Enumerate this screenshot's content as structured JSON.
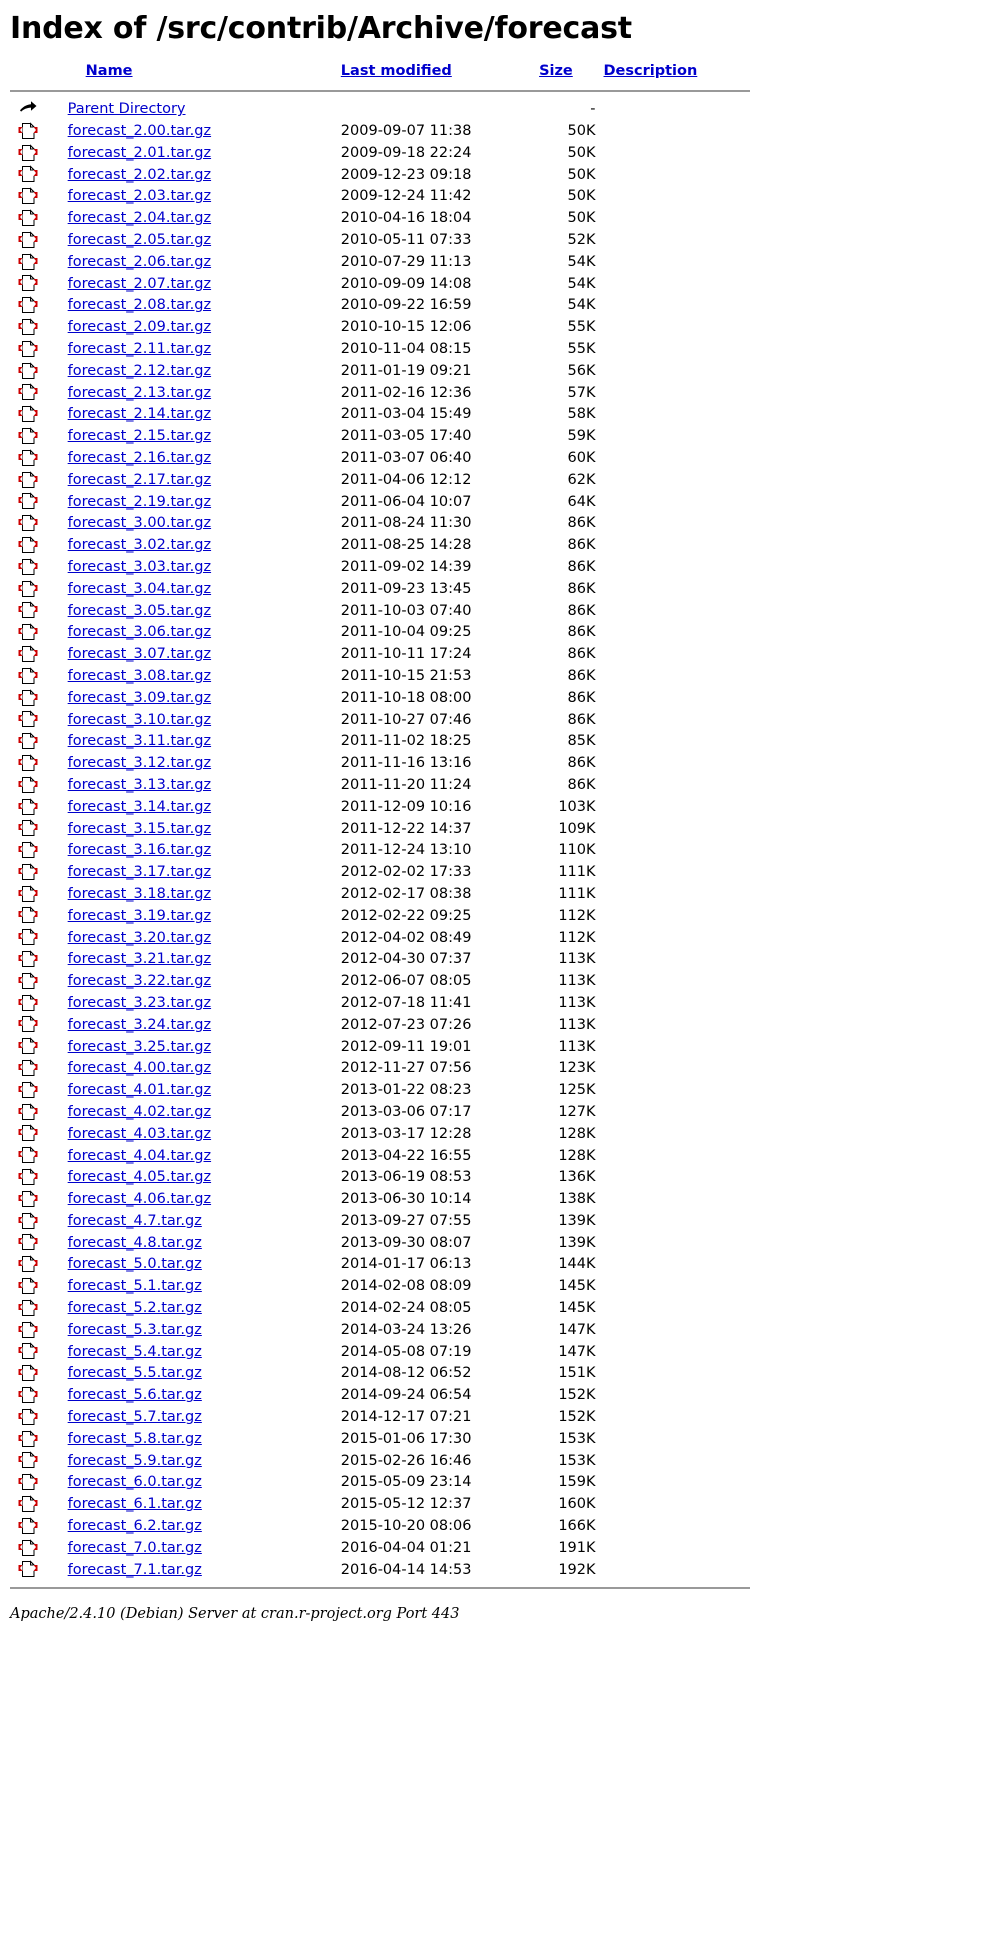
{
  "page": {
    "title": "Index of /src/contrib/Archive/forecast",
    "parent_directory_label": "Parent Directory",
    "parent_directory_size": "-",
    "footer": "Apache/2.4.10 (Debian) Server at cran.r-project.org Port 443"
  },
  "colors": {
    "link": "#0000cc",
    "rule": "#999999",
    "text": "#000000",
    "background": "#ffffff",
    "icon_red": "#cc0000"
  },
  "columns": {
    "icon": "",
    "name": "Name",
    "last_modified": "Last modified",
    "size": "Size",
    "description": "Description"
  },
  "icons": {
    "parent": "back-arrow-icon",
    "file": "compressed-file-icon"
  },
  "rows": [
    {
      "name": "forecast_2.00.tar.gz",
      "modified": "2009-09-07 11:38",
      "size": "50K",
      "description": ""
    },
    {
      "name": "forecast_2.01.tar.gz",
      "modified": "2009-09-18 22:24",
      "size": "50K",
      "description": ""
    },
    {
      "name": "forecast_2.02.tar.gz",
      "modified": "2009-12-23 09:18",
      "size": "50K",
      "description": ""
    },
    {
      "name": "forecast_2.03.tar.gz",
      "modified": "2009-12-24 11:42",
      "size": "50K",
      "description": ""
    },
    {
      "name": "forecast_2.04.tar.gz",
      "modified": "2010-04-16 18:04",
      "size": "50K",
      "description": ""
    },
    {
      "name": "forecast_2.05.tar.gz",
      "modified": "2010-05-11 07:33",
      "size": "52K",
      "description": ""
    },
    {
      "name": "forecast_2.06.tar.gz",
      "modified": "2010-07-29 11:13",
      "size": "54K",
      "description": ""
    },
    {
      "name": "forecast_2.07.tar.gz",
      "modified": "2010-09-09 14:08",
      "size": "54K",
      "description": ""
    },
    {
      "name": "forecast_2.08.tar.gz",
      "modified": "2010-09-22 16:59",
      "size": "54K",
      "description": ""
    },
    {
      "name": "forecast_2.09.tar.gz",
      "modified": "2010-10-15 12:06",
      "size": "55K",
      "description": ""
    },
    {
      "name": "forecast_2.11.tar.gz",
      "modified": "2010-11-04 08:15",
      "size": "55K",
      "description": ""
    },
    {
      "name": "forecast_2.12.tar.gz",
      "modified": "2011-01-19 09:21",
      "size": "56K",
      "description": ""
    },
    {
      "name": "forecast_2.13.tar.gz",
      "modified": "2011-02-16 12:36",
      "size": "57K",
      "description": ""
    },
    {
      "name": "forecast_2.14.tar.gz",
      "modified": "2011-03-04 15:49",
      "size": "58K",
      "description": ""
    },
    {
      "name": "forecast_2.15.tar.gz",
      "modified": "2011-03-05 17:40",
      "size": "59K",
      "description": ""
    },
    {
      "name": "forecast_2.16.tar.gz",
      "modified": "2011-03-07 06:40",
      "size": "60K",
      "description": ""
    },
    {
      "name": "forecast_2.17.tar.gz",
      "modified": "2011-04-06 12:12",
      "size": "62K",
      "description": ""
    },
    {
      "name": "forecast_2.19.tar.gz",
      "modified": "2011-06-04 10:07",
      "size": "64K",
      "description": ""
    },
    {
      "name": "forecast_3.00.tar.gz",
      "modified": "2011-08-24 11:30",
      "size": "86K",
      "description": ""
    },
    {
      "name": "forecast_3.02.tar.gz",
      "modified": "2011-08-25 14:28",
      "size": "86K",
      "description": ""
    },
    {
      "name": "forecast_3.03.tar.gz",
      "modified": "2011-09-02 14:39",
      "size": "86K",
      "description": ""
    },
    {
      "name": "forecast_3.04.tar.gz",
      "modified": "2011-09-23 13:45",
      "size": "86K",
      "description": ""
    },
    {
      "name": "forecast_3.05.tar.gz",
      "modified": "2011-10-03 07:40",
      "size": "86K",
      "description": ""
    },
    {
      "name": "forecast_3.06.tar.gz",
      "modified": "2011-10-04 09:25",
      "size": "86K",
      "description": ""
    },
    {
      "name": "forecast_3.07.tar.gz",
      "modified": "2011-10-11 17:24",
      "size": "86K",
      "description": ""
    },
    {
      "name": "forecast_3.08.tar.gz",
      "modified": "2011-10-15 21:53",
      "size": "86K",
      "description": ""
    },
    {
      "name": "forecast_3.09.tar.gz",
      "modified": "2011-10-18 08:00",
      "size": "86K",
      "description": ""
    },
    {
      "name": "forecast_3.10.tar.gz",
      "modified": "2011-10-27 07:46",
      "size": "86K",
      "description": ""
    },
    {
      "name": "forecast_3.11.tar.gz",
      "modified": "2011-11-02 18:25",
      "size": "85K",
      "description": ""
    },
    {
      "name": "forecast_3.12.tar.gz",
      "modified": "2011-11-16 13:16",
      "size": "86K",
      "description": ""
    },
    {
      "name": "forecast_3.13.tar.gz",
      "modified": "2011-11-20 11:24",
      "size": "86K",
      "description": ""
    },
    {
      "name": "forecast_3.14.tar.gz",
      "modified": "2011-12-09 10:16",
      "size": "103K",
      "description": ""
    },
    {
      "name": "forecast_3.15.tar.gz",
      "modified": "2011-12-22 14:37",
      "size": "109K",
      "description": ""
    },
    {
      "name": "forecast_3.16.tar.gz",
      "modified": "2011-12-24 13:10",
      "size": "110K",
      "description": ""
    },
    {
      "name": "forecast_3.17.tar.gz",
      "modified": "2012-02-02 17:33",
      "size": "111K",
      "description": ""
    },
    {
      "name": "forecast_3.18.tar.gz",
      "modified": "2012-02-17 08:38",
      "size": "111K",
      "description": ""
    },
    {
      "name": "forecast_3.19.tar.gz",
      "modified": "2012-02-22 09:25",
      "size": "112K",
      "description": ""
    },
    {
      "name": "forecast_3.20.tar.gz",
      "modified": "2012-04-02 08:49",
      "size": "112K",
      "description": ""
    },
    {
      "name": "forecast_3.21.tar.gz",
      "modified": "2012-04-30 07:37",
      "size": "113K",
      "description": ""
    },
    {
      "name": "forecast_3.22.tar.gz",
      "modified": "2012-06-07 08:05",
      "size": "113K",
      "description": ""
    },
    {
      "name": "forecast_3.23.tar.gz",
      "modified": "2012-07-18 11:41",
      "size": "113K",
      "description": ""
    },
    {
      "name": "forecast_3.24.tar.gz",
      "modified": "2012-07-23 07:26",
      "size": "113K",
      "description": ""
    },
    {
      "name": "forecast_3.25.tar.gz",
      "modified": "2012-09-11 19:01",
      "size": "113K",
      "description": ""
    },
    {
      "name": "forecast_4.00.tar.gz",
      "modified": "2012-11-27 07:56",
      "size": "123K",
      "description": ""
    },
    {
      "name": "forecast_4.01.tar.gz",
      "modified": "2013-01-22 08:23",
      "size": "125K",
      "description": ""
    },
    {
      "name": "forecast_4.02.tar.gz",
      "modified": "2013-03-06 07:17",
      "size": "127K",
      "description": ""
    },
    {
      "name": "forecast_4.03.tar.gz",
      "modified": "2013-03-17 12:28",
      "size": "128K",
      "description": ""
    },
    {
      "name": "forecast_4.04.tar.gz",
      "modified": "2013-04-22 16:55",
      "size": "128K",
      "description": ""
    },
    {
      "name": "forecast_4.05.tar.gz",
      "modified": "2013-06-19 08:53",
      "size": "136K",
      "description": ""
    },
    {
      "name": "forecast_4.06.tar.gz",
      "modified": "2013-06-30 10:14",
      "size": "138K",
      "description": ""
    },
    {
      "name": "forecast_4.7.tar.gz",
      "modified": "2013-09-27 07:55",
      "size": "139K",
      "description": ""
    },
    {
      "name": "forecast_4.8.tar.gz",
      "modified": "2013-09-30 08:07",
      "size": "139K",
      "description": ""
    },
    {
      "name": "forecast_5.0.tar.gz",
      "modified": "2014-01-17 06:13",
      "size": "144K",
      "description": ""
    },
    {
      "name": "forecast_5.1.tar.gz",
      "modified": "2014-02-08 08:09",
      "size": "145K",
      "description": ""
    },
    {
      "name": "forecast_5.2.tar.gz",
      "modified": "2014-02-24 08:05",
      "size": "145K",
      "description": ""
    },
    {
      "name": "forecast_5.3.tar.gz",
      "modified": "2014-03-24 13:26",
      "size": "147K",
      "description": ""
    },
    {
      "name": "forecast_5.4.tar.gz",
      "modified": "2014-05-08 07:19",
      "size": "147K",
      "description": ""
    },
    {
      "name": "forecast_5.5.tar.gz",
      "modified": "2014-08-12 06:52",
      "size": "151K",
      "description": ""
    },
    {
      "name": "forecast_5.6.tar.gz",
      "modified": "2014-09-24 06:54",
      "size": "152K",
      "description": ""
    },
    {
      "name": "forecast_5.7.tar.gz",
      "modified": "2014-12-17 07:21",
      "size": "152K",
      "description": ""
    },
    {
      "name": "forecast_5.8.tar.gz",
      "modified": "2015-01-06 17:30",
      "size": "153K",
      "description": ""
    },
    {
      "name": "forecast_5.9.tar.gz",
      "modified": "2015-02-26 16:46",
      "size": "153K",
      "description": ""
    },
    {
      "name": "forecast_6.0.tar.gz",
      "modified": "2015-05-09 23:14",
      "size": "159K",
      "description": ""
    },
    {
      "name": "forecast_6.1.tar.gz",
      "modified": "2015-05-12 12:37",
      "size": "160K",
      "description": ""
    },
    {
      "name": "forecast_6.2.tar.gz",
      "modified": "2015-10-20 08:06",
      "size": "166K",
      "description": ""
    },
    {
      "name": "forecast_7.0.tar.gz",
      "modified": "2016-04-04 01:21",
      "size": "191K",
      "description": ""
    },
    {
      "name": "forecast_7.1.tar.gz",
      "modified": "2016-04-14 14:53",
      "size": "192K",
      "description": ""
    }
  ]
}
